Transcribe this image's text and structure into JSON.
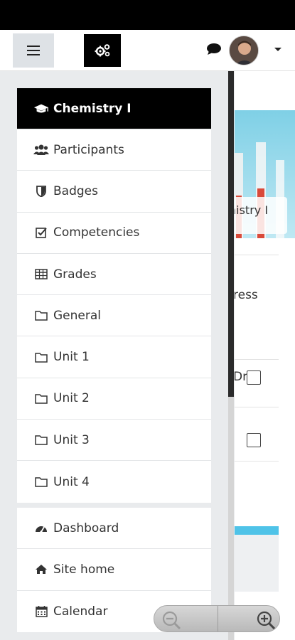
{
  "navbar": {
    "menu_icon": "hamburger-icon",
    "logo_icon": "cogs-icon",
    "chat_icon": "comment-icon",
    "user_menu_icon": "caret-down-icon"
  },
  "drawer": {
    "course": {
      "active_item": {
        "label": "Chemistry I",
        "icon": "graduation-cap-icon"
      },
      "items": [
        {
          "label": "Participants",
          "icon": "users-icon"
        },
        {
          "label": "Badges",
          "icon": "shield-icon"
        },
        {
          "label": "Competencies",
          "icon": "check-square-icon"
        },
        {
          "label": "Grades",
          "icon": "table-icon"
        },
        {
          "label": "General",
          "icon": "folder-icon"
        },
        {
          "label": "Unit 1",
          "icon": "folder-icon"
        },
        {
          "label": "Unit 2",
          "icon": "folder-icon"
        },
        {
          "label": "Unit 3",
          "icon": "folder-icon"
        },
        {
          "label": "Unit 4",
          "icon": "folder-icon"
        }
      ]
    },
    "site": {
      "items": [
        {
          "label": "Dashboard",
          "icon": "tachometer-icon"
        },
        {
          "label": "Site home",
          "icon": "home-icon"
        },
        {
          "label": "Calendar",
          "icon": "calendar-icon"
        }
      ]
    }
  },
  "background": {
    "hero_label": "nistry I",
    "progress_text": "ress",
    "row_text": "Dr"
  },
  "zoom": {
    "zoom_out_icon": "zoom-out-icon",
    "zoom_in_icon": "zoom-in-icon"
  },
  "colors": {
    "active_bg": "#000000",
    "drawer_bg": "#e9ebed",
    "accent_bar": "#4fc3e8"
  }
}
